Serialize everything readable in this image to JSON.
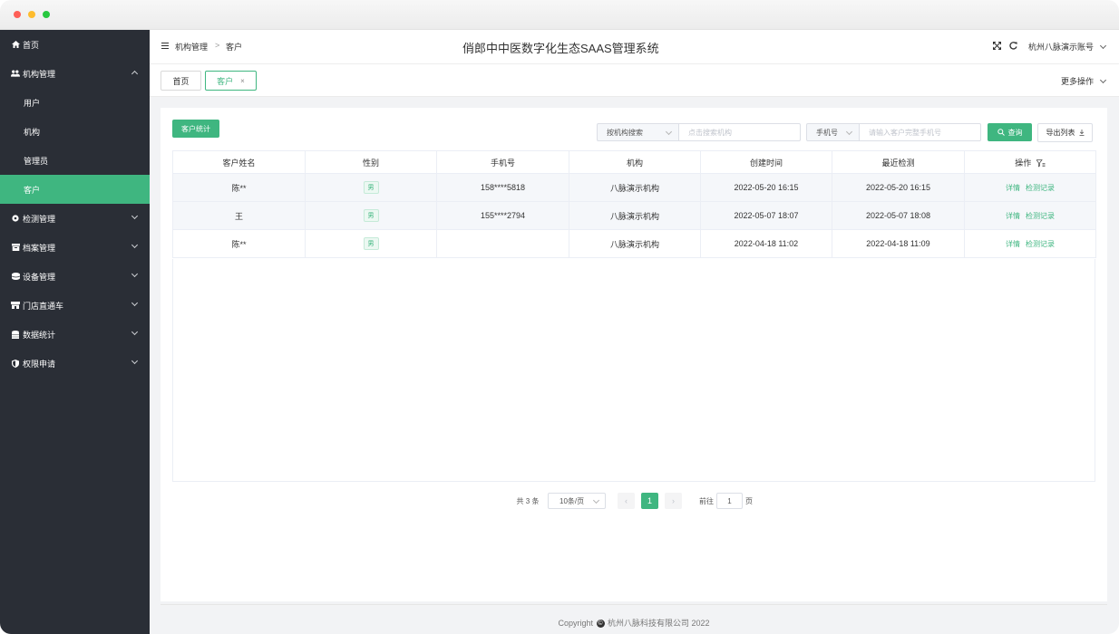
{
  "app": {
    "title": "俏郎中中医数字化生态SAAS管理系统",
    "account": "杭州八脉演示账号"
  },
  "sidebar": {
    "items": [
      {
        "label": "首页",
        "icon": "home-icon"
      },
      {
        "label": "机构管理",
        "icon": "users-icon",
        "expanded": true
      },
      {
        "label": "用户"
      },
      {
        "label": "机构"
      },
      {
        "label": "管理员"
      },
      {
        "label": "客户",
        "active": true
      },
      {
        "label": "检测管理",
        "icon": "detect-icon"
      },
      {
        "label": "档案管理",
        "icon": "archive-icon"
      },
      {
        "label": "设备管理",
        "icon": "device-icon"
      },
      {
        "label": "门店直通车",
        "icon": "store-icon"
      },
      {
        "label": "数据统计",
        "icon": "database-icon"
      },
      {
        "label": "权限申请",
        "icon": "shield-icon"
      }
    ]
  },
  "breadcrumb": {
    "parent": "机构管理",
    "separator": ">",
    "current": "客户"
  },
  "tabs": {
    "home": "首页",
    "customer": "客户",
    "close": "×",
    "more": "更多操作"
  },
  "toolbar": {
    "stats_button": "客户统计",
    "org_select": "按机构搜索",
    "org_placeholder": "点击搜索机构",
    "phone_select": "手机号",
    "phone_placeholder": "请输入客户完整手机号",
    "query_button": "查询",
    "export_button": "导出列表"
  },
  "table": {
    "headers": [
      "客户姓名",
      "性别",
      "手机号",
      "机构",
      "创建时间",
      "最近检测",
      "操作"
    ],
    "rows": [
      {
        "name": "陈**",
        "gender": "男",
        "phone": "158****5818",
        "org": "八脉演示机构",
        "created": "2022-05-20 16:15",
        "last": "2022-05-20 16:15",
        "detail": "详情",
        "record": "检测记录"
      },
      {
        "name": "王",
        "gender": "男",
        "phone": "155****2794",
        "org": "八脉演示机构",
        "created": "2022-05-07 18:07",
        "last": "2022-05-07 18:08",
        "detail": "详情",
        "record": "检测记录"
      },
      {
        "name": "陈**",
        "gender": "男",
        "phone": "",
        "org": "八脉演示机构",
        "created": "2022-04-18 11:02",
        "last": "2022-04-18 11:09",
        "detail": "详情",
        "record": "检测记录"
      }
    ]
  },
  "pagination": {
    "total": "共 3 条",
    "page_size": "10条/页",
    "prev": "‹",
    "current": "1",
    "next": "›",
    "goto_label": "前往",
    "goto_value": "1",
    "page_unit": "页"
  },
  "footer": {
    "prefix": "Copyright",
    "symbol": "©",
    "text": "杭州八脉科技有限公司 2022"
  },
  "colors": {
    "accent": "#3fb680",
    "sidebar_bg": "#2a2e36"
  }
}
